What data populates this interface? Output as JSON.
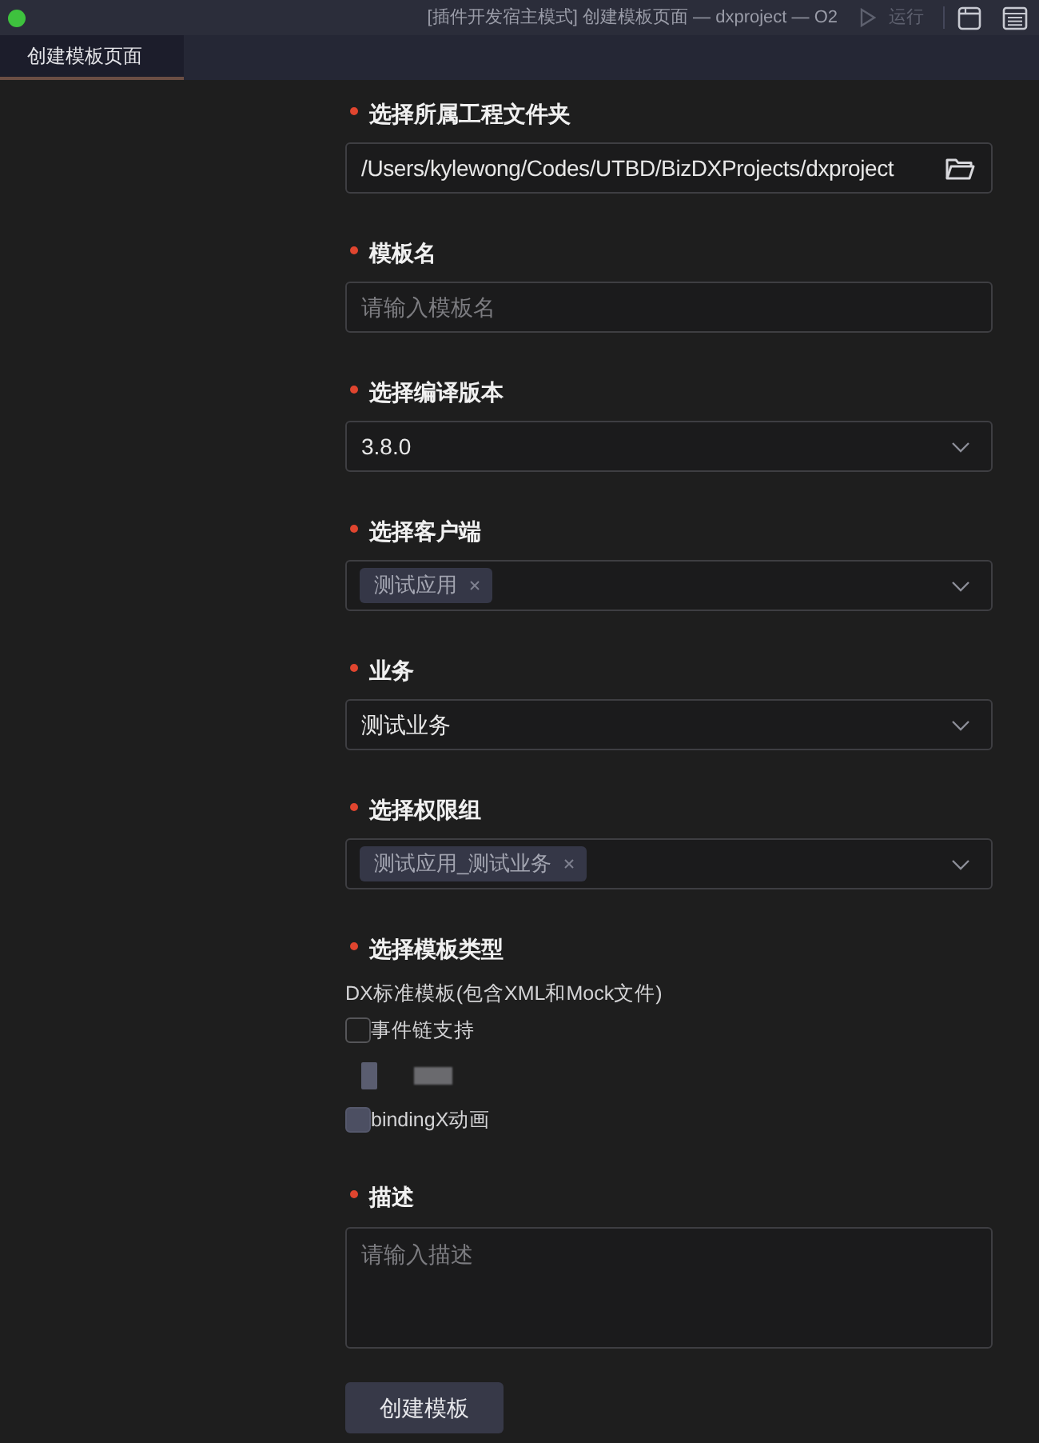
{
  "window": {
    "title": "[插件开发宿主模式] 创建模板页面 — dxproject — O2",
    "run_label": "运行"
  },
  "tabs": [
    {
      "label": "创建模板页面",
      "selected": true
    }
  ],
  "form": {
    "fields": [
      {
        "kind": "folder",
        "label": "选择所属工程文件夹",
        "required": true,
        "value": "/Users/kylewong/Codes/UTBD/BizDXProjects/dxproject"
      },
      {
        "kind": "text",
        "label": "模板名",
        "required": true,
        "placeholder": "请输入模板名"
      },
      {
        "kind": "select",
        "label": "选择编译版本",
        "required": true,
        "value": "3.8.0"
      },
      {
        "kind": "multiselect",
        "label": "选择客户端",
        "required": true,
        "tags": [
          "测试应用"
        ]
      },
      {
        "kind": "select",
        "label": "业务",
        "required": true,
        "value": "测试业务"
      },
      {
        "kind": "multiselect",
        "label": "选择权限组",
        "required": true,
        "tags": [
          "测试应用_测试业务"
        ]
      },
      {
        "kind": "options",
        "label": "选择模板类型",
        "required": true,
        "note": "DX标准模板(包含XML和Mock文件)",
        "options": [
          {
            "kind": "checkbox",
            "label": "事件链支持",
            "disabled": false
          },
          {
            "kind": "redacted",
            "disabled": true
          },
          {
            "kind": "checkbox",
            "label": "bindingX动画",
            "disabled": true
          }
        ]
      },
      {
        "kind": "textarea",
        "label": "描述",
        "required": true,
        "placeholder": "请输入描述"
      }
    ],
    "submit": "创建模板"
  }
}
